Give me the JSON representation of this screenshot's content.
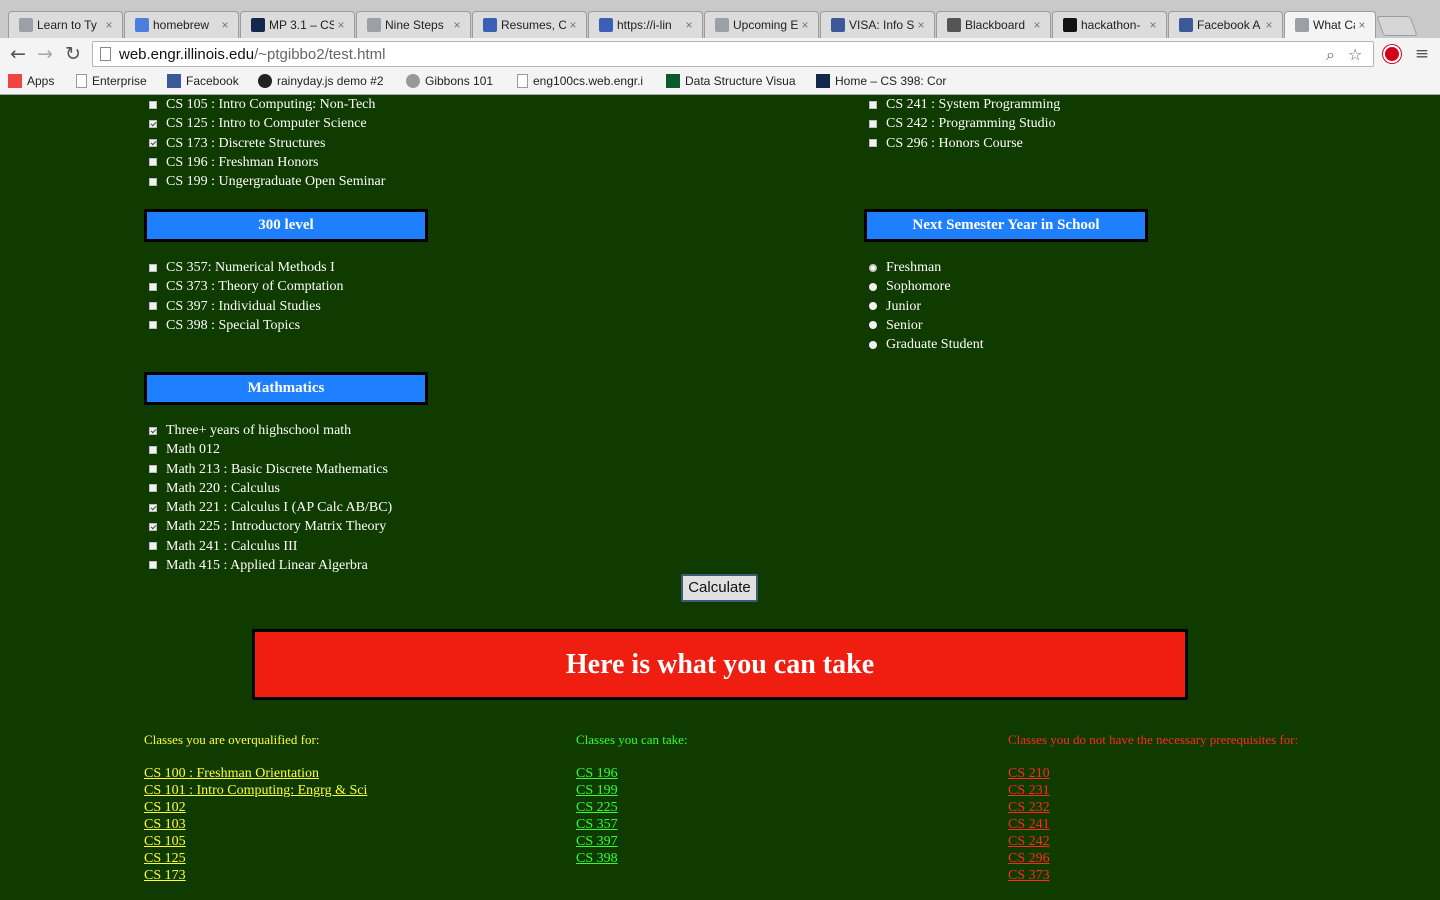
{
  "browser": {
    "tabs": [
      {
        "title": "Learn to Ty",
        "favicon": "page-icon",
        "color": "#9aa0a6"
      },
      {
        "title": "homebrew",
        "favicon": "google-icon",
        "color": "#4a7fe0"
      },
      {
        "title": "MP 3.1 – CS",
        "favicon": "illinois-icon",
        "color": "#13294b"
      },
      {
        "title": "Nine Steps",
        "favicon": "loading-icon",
        "color": "#9aa0a6"
      },
      {
        "title": "Resumes, C",
        "favicon": "doc-icon",
        "color": "#3b5fb6"
      },
      {
        "title": "https://i-lin",
        "favicon": "doc-icon",
        "color": "#3b5fb6"
      },
      {
        "title": "Upcoming E",
        "favicon": "loading-icon",
        "color": "#9aa0a6"
      },
      {
        "title": "VISA: Info S",
        "favicon": "facebook-icon",
        "color": "#3b5998"
      },
      {
        "title": "Blackboard",
        "favicon": "blackboard-icon",
        "color": "#555555"
      },
      {
        "title": "hackathon-",
        "favicon": "github-icon",
        "color": "#111111"
      },
      {
        "title": "Facebook A",
        "favicon": "facebook-icon",
        "color": "#3b5998"
      },
      {
        "title": "What Can I",
        "favicon": "loading-icon",
        "color": "#9aa0a6"
      }
    ],
    "url_host": "web.engr.illinois.edu",
    "url_path": "/~ptgibbo2/test.html",
    "bookmarks": [
      {
        "label": "Apps",
        "icon": "apps-grid-icon"
      },
      {
        "label": "Enterprise",
        "icon": "page-icon"
      },
      {
        "label": "Facebook",
        "icon": "facebook-icon"
      },
      {
        "label": "rainyday.js demo #2",
        "icon": "raindrop-icon"
      },
      {
        "label": "Gibbons 101",
        "icon": "gear-icon"
      },
      {
        "label": "eng100cs.web.engr.i",
        "icon": "page-icon"
      },
      {
        "label": "Data Structure Visua",
        "icon": "usf-icon"
      },
      {
        "label": "Home – CS 398: Cor",
        "icon": "illinois-icon"
      }
    ]
  },
  "courses_left_top": [
    {
      "label": "CS 105 : Intro Computing: Non-Tech",
      "checked": false
    },
    {
      "label": "CS 125 : Intro to Computer Science",
      "checked": true
    },
    {
      "label": "CS 173 : Discrete Structures",
      "checked": true
    },
    {
      "label": "CS 196 : Freshman Honors",
      "checked": false
    },
    {
      "label": "CS 199 : Ungergraduate Open Seminar",
      "checked": false
    }
  ],
  "courses_right_top": [
    {
      "label": "CS 241 : System Programming",
      "checked": false
    },
    {
      "label": "CS 242 : Programming Studio",
      "checked": false
    },
    {
      "label": "CS 296 : Honors Course",
      "checked": false
    }
  ],
  "section_300": {
    "title": "300 level",
    "items": [
      {
        "label": "CS 357: Numerical Methods I",
        "checked": false
      },
      {
        "label": "CS 373 : Theory of Comptation",
        "checked": false
      },
      {
        "label": "CS 397 : Individual Studies",
        "checked": false
      },
      {
        "label": "CS 398 : Special Topics",
        "checked": false
      }
    ]
  },
  "section_year": {
    "title": "Next Semester Year in School",
    "items": [
      {
        "label": "Freshman",
        "selected": true
      },
      {
        "label": "Sophomore",
        "selected": false
      },
      {
        "label": "Junior",
        "selected": false
      },
      {
        "label": "Senior",
        "selected": false
      },
      {
        "label": "Graduate Student",
        "selected": false
      }
    ]
  },
  "section_math": {
    "title": "Mathmatics",
    "items": [
      {
        "label": "Three+ years of highschool math",
        "checked": true
      },
      {
        "label": "Math 012",
        "checked": false
      },
      {
        "label": "Math 213 : Basic Discrete Mathematics",
        "checked": false
      },
      {
        "label": "Math 220 : Calculus",
        "checked": false
      },
      {
        "label": "Math 221 : Calculus I (AP Calc AB/BC)",
        "checked": true
      },
      {
        "label": "Math 225 : Introductory Matrix Theory",
        "checked": true
      },
      {
        "label": "Math 241 : Calculus III",
        "checked": false
      },
      {
        "label": "Math 415 : Applied Linear Algerbra",
        "checked": false
      }
    ]
  },
  "calculate_label": "Calculate",
  "banner_text": "Here is what you can take",
  "results": {
    "overqualified": {
      "heading": "Classes you are overqualified for:",
      "color": "#ffff33",
      "items": [
        "CS 100 : Freshman Orientation",
        "CS 101 : Intro Computing: Engrg & Sci",
        "CS 102",
        "CS 103",
        "CS 105",
        "CS 125",
        "CS 173"
      ]
    },
    "can_take": {
      "heading": "Classes you can take:",
      "color": "#33ff33",
      "items": [
        "CS 196",
        "CS 199",
        "CS 225",
        "CS 357",
        "CS 397",
        "CS 398"
      ]
    },
    "missing_prereqs": {
      "heading": "Classes you do not have the necessary prerequisites for:",
      "color": "#ff2a1a",
      "items": [
        "CS 210",
        "CS 231",
        "CS 232",
        "CS 241",
        "CS 242",
        "CS 296",
        "CS 373"
      ]
    }
  }
}
